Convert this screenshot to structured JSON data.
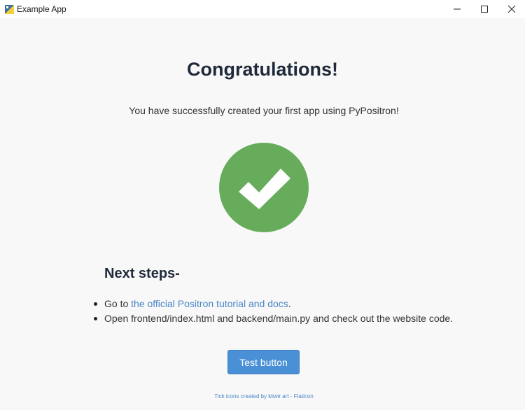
{
  "window": {
    "title": "Example App",
    "controls": {
      "minimize_icon": "minimize-icon",
      "maximize_icon": "maximize-icon",
      "close_icon": "close-icon"
    }
  },
  "main": {
    "heading": "Congratulations!",
    "subtitle": "You have successfully created your first app using PyPositron!",
    "success_icon": "checkmark-circle-icon",
    "next_steps_heading": "Next steps-",
    "steps": [
      {
        "prefix": "Go to ",
        "link_text": "the official Positron tutorial and docs",
        "suffix": "."
      },
      {
        "text": "Open frontend/index.html and backend/main.py and check out the website code."
      }
    ],
    "test_button_label": "Test button",
    "credit": "Tick icons created by kliwir art - Flaticon"
  },
  "colors": {
    "accent": "#4a90d6",
    "link": "#4a86c5",
    "success": "#66ac5b",
    "heading": "#1e2a3a",
    "background": "#f8f8f8"
  }
}
